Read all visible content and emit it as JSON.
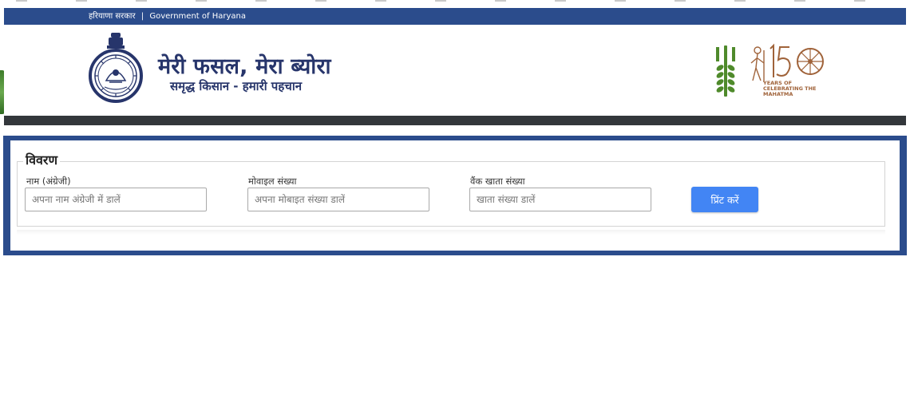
{
  "govbar": {
    "hindi": "हरियाणा सरकार",
    "separator": "|",
    "english": "Government of Haryana"
  },
  "header": {
    "title": "मेरी फसल, मेरा ब्योरा",
    "subtitle": "समृद्ध किसान - हमारी पहचान",
    "emblem_icon": "haryana-state-emblem",
    "right_logos": [
      "wheat-logo",
      "gandhi-150-logo"
    ],
    "gandhi_logo_text": "YEARS OF CELEBRATING THE MAHATMA",
    "gandhi_logo_number": "150"
  },
  "form": {
    "legend": "विवरण",
    "fields": [
      {
        "label": "नाम (अंग्रेजी)",
        "placeholder": "अपना नाम अंग्रेजी में डालें",
        "value": ""
      },
      {
        "label": "मोवाइल संख्या",
        "placeholder": "अपना मोबाइत संख्या डालें",
        "value": ""
      },
      {
        "label": "वैंक खाता संख्या",
        "placeholder": "खाता संख्या डालें",
        "value": ""
      }
    ],
    "print_button": "प्रिंट करें"
  },
  "colors": {
    "primary_blue": "#2b4c8c",
    "title_navy": "#27356b",
    "dark_bar": "#33373b",
    "button_blue": "#4285f4",
    "logo_green": "#4f8a2b",
    "logo_brown": "#a0633a"
  }
}
